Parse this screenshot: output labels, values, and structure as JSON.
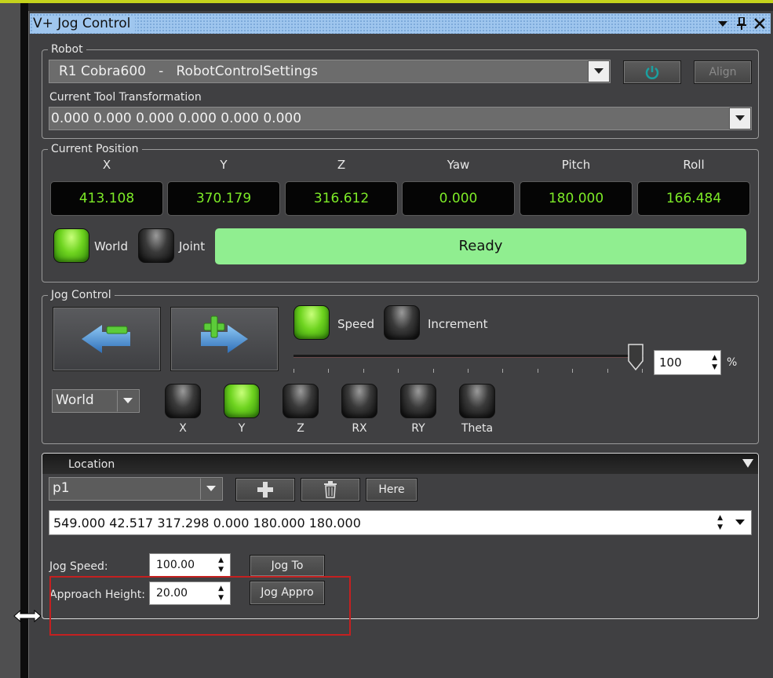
{
  "window": {
    "title": "V+ Jog Control"
  },
  "icons": {
    "dropdown": "dropdown-icon",
    "pin": "pin-icon",
    "close": "close-icon",
    "power": "power-icon",
    "plus": "plus-icon",
    "trash": "trash-icon",
    "resize": "resize-cursor-icon"
  },
  "robot": {
    "group_label": "Robot",
    "selected": "R1 Cobra600   -   RobotControlSettings",
    "align_label": "Align",
    "tool_label": "Current Tool Transformation",
    "tool_value": "0.000 0.000 0.000 0.000 0.000 0.000"
  },
  "position": {
    "group_label": "Current Position",
    "columns": [
      {
        "label": "X",
        "value": "413.108"
      },
      {
        "label": "Y",
        "value": "370.179"
      },
      {
        "label": "Z",
        "value": "316.612"
      },
      {
        "label": "Yaw",
        "value": "0.000"
      },
      {
        "label": "Pitch",
        "value": "180.000"
      },
      {
        "label": "Roll",
        "value": "166.484"
      }
    ],
    "world_label": "World",
    "joint_label": "Joint",
    "status": "Ready"
  },
  "jog": {
    "group_label": "Jog Control",
    "speed_label": "Speed",
    "increment_label": "Increment",
    "speed_percent": "100",
    "percent_symbol": "%",
    "slider_value_fraction": 1.0,
    "frame": "World",
    "axes": [
      {
        "label": "X",
        "on": false
      },
      {
        "label": "Y",
        "on": true
      },
      {
        "label": "Z",
        "on": false
      },
      {
        "label": "RX",
        "on": false
      },
      {
        "label": "RY",
        "on": false
      },
      {
        "label": "Theta",
        "on": false
      }
    ]
  },
  "location": {
    "header": "Location",
    "selected": "p1",
    "here_label": "Here",
    "value": "549.000 42.517 317.298 0.000 180.000 180.000",
    "jog_speed_label": "Jog Speed:",
    "jog_speed_value": "100.00",
    "jog_to_label": "Jog To",
    "approach_label": "Approach Height:",
    "approach_value": "20.00",
    "jog_appro_label": "Jog Appro"
  },
  "colors": {
    "accent_green": "#7dea27",
    "ready_bg": "#90ee90",
    "titlebar": "#9fc6ee",
    "highlight_red": "#c42020"
  }
}
